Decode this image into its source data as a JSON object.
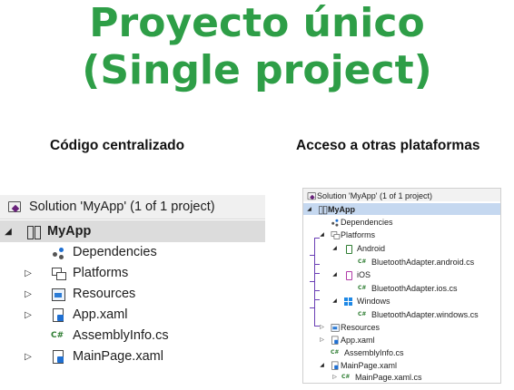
{
  "title": {
    "line1": "Proyecto único",
    "line2": "(Single project)"
  },
  "left": {
    "heading": "Código centralizado",
    "solution_label": "Solution 'MyApp' (1 of 1 project)",
    "project_label": "MyApp",
    "items": [
      {
        "label": "Dependencies",
        "icon": "dependencies-icon"
      },
      {
        "label": "Platforms",
        "icon": "platforms-icon"
      },
      {
        "label": "Resources",
        "icon": "resources-icon"
      },
      {
        "label": "App.xaml",
        "icon": "xaml-file-icon"
      },
      {
        "label": "AssemblyInfo.cs",
        "icon": "csharp-file-icon"
      },
      {
        "label": "MainPage.xaml",
        "icon": "xaml-file-icon"
      }
    ]
  },
  "right": {
    "heading": "Acceso a otras plataformas",
    "solution_label": "Solution 'MyApp' (1 of 1 project)",
    "project_label": "MyApp",
    "items": [
      {
        "label": "Dependencies"
      },
      {
        "label": "Platforms"
      },
      {
        "label": "Android"
      },
      {
        "label": "BluetoothAdapter.android.cs"
      },
      {
        "label": "iOS"
      },
      {
        "label": "BluetoothAdapter.ios.cs"
      },
      {
        "label": "Windows"
      },
      {
        "label": "BluetoothAdapter.windows.cs"
      },
      {
        "label": "Resources"
      },
      {
        "label": "App.xaml"
      },
      {
        "label": "AssemblyInfo.cs"
      },
      {
        "label": "MainPage.xaml"
      },
      {
        "label": "MainPage.xaml.cs"
      }
    ]
  },
  "glyphs": {
    "csharp": "C#",
    "expanded": "◢",
    "collapsed": "▷"
  },
  "colors": {
    "title_green": "#2e9e47",
    "bracket_purple": "#6a3fb5",
    "selection_blue": "#c5d8f0"
  }
}
